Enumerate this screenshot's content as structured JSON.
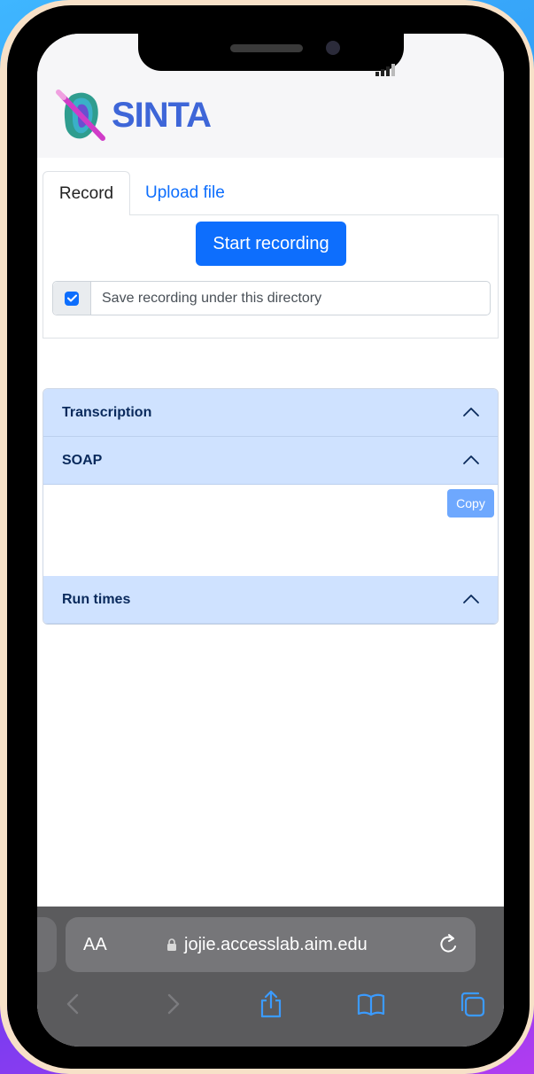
{
  "app": {
    "name": "SINTA"
  },
  "tabs": [
    {
      "label": "Record",
      "active": true
    },
    {
      "label": "Upload file",
      "active": false
    }
  ],
  "record": {
    "start_button": "Start recording",
    "save_checkbox": {
      "label": "Save recording under this directory",
      "checked": true
    }
  },
  "accordion": [
    {
      "title": "Transcription",
      "expanded": true
    },
    {
      "title": "SOAP",
      "expanded": true,
      "copy_button": "Copy"
    },
    {
      "title": "Run times",
      "expanded": true
    }
  ],
  "browser": {
    "text_size_label": "AA",
    "url": "jojie.accesslab.aim.edu"
  },
  "colors": {
    "primary": "#0d6efd",
    "accordion_header": "#cfe2ff",
    "logo_text": "#3e66d8",
    "browser_bar": "#5b5b5d"
  }
}
